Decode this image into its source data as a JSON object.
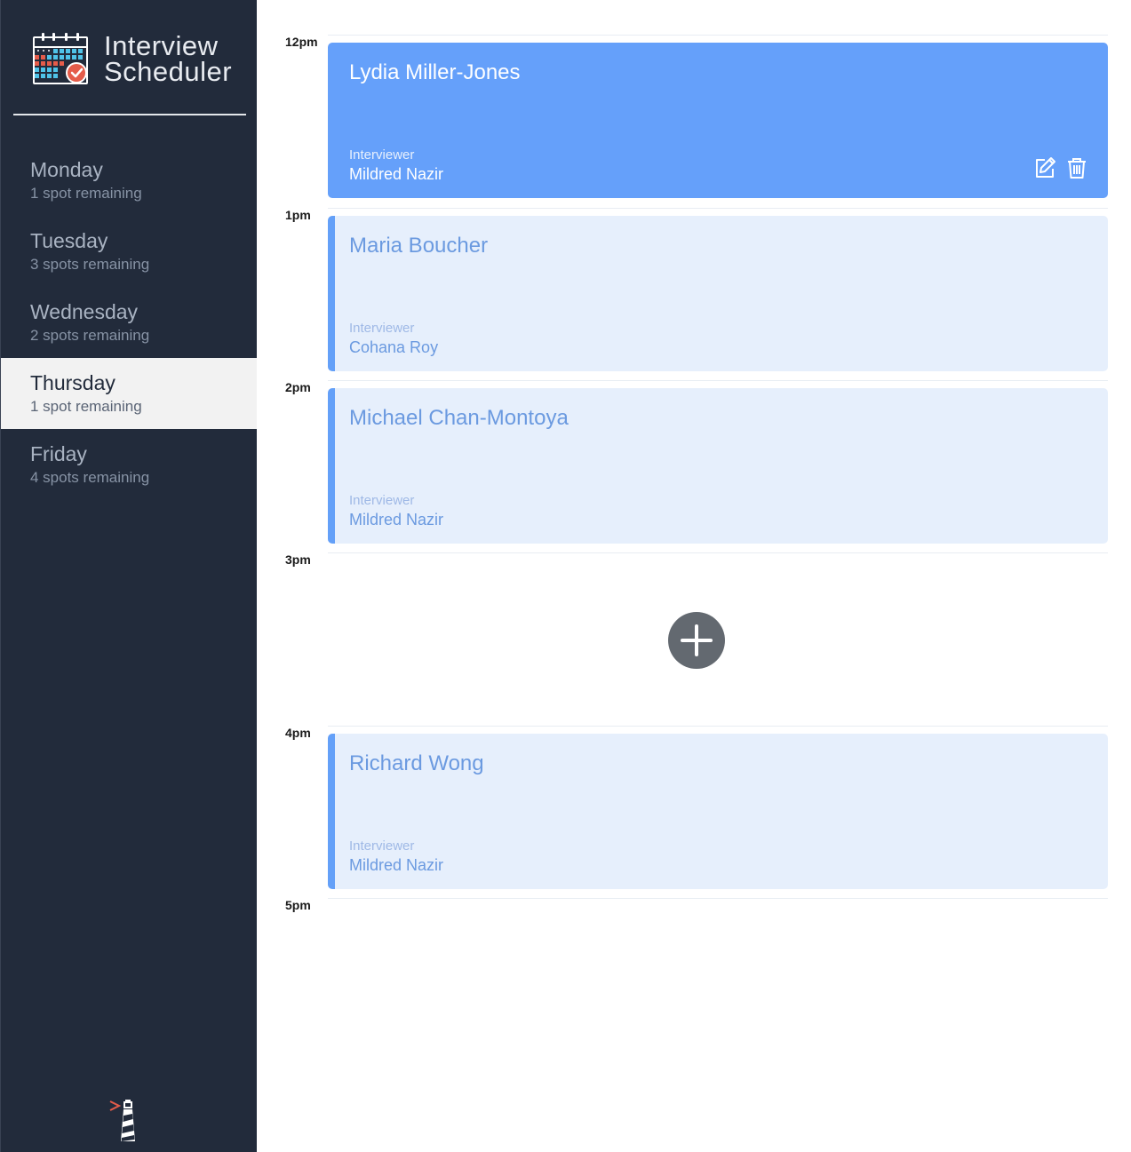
{
  "app": {
    "title_line1": "Interview",
    "title_line2": "Scheduler"
  },
  "sidebar": {
    "days": [
      {
        "name": "Monday",
        "spots": "1 spot remaining",
        "selected": false
      },
      {
        "name": "Tuesday",
        "spots": "3 spots remaining",
        "selected": false
      },
      {
        "name": "Wednesday",
        "spots": "2 spots remaining",
        "selected": false
      },
      {
        "name": "Thursday",
        "spots": "1 spot remaining",
        "selected": true
      },
      {
        "name": "Friday",
        "spots": "4 spots remaining",
        "selected": false
      }
    ],
    "footer_icon": "lighthouse-icon"
  },
  "schedule": {
    "times": [
      "12pm",
      "1pm",
      "2pm",
      "3pm",
      "4pm",
      "5pm"
    ],
    "appointments": [
      {
        "time": "12pm",
        "student": "Lydia Miller-Jones",
        "interviewer_label": "Interviewer",
        "interviewer": "Mildred Nazir",
        "active": true,
        "actions": [
          "edit-icon",
          "trash-icon"
        ]
      },
      {
        "time": "1pm",
        "student": "Maria Boucher",
        "interviewer_label": "Interviewer",
        "interviewer": "Cohana Roy",
        "active": false
      },
      {
        "time": "2pm",
        "student": "Michael Chan-Montoya",
        "interviewer_label": "Interviewer",
        "interviewer": "Mildred Nazir",
        "active": false
      },
      {
        "time": "4pm",
        "student": "Richard Wong",
        "interviewer_label": "Interviewer",
        "interviewer": "Mildred Nazir",
        "active": false
      }
    ],
    "empty_slot": {
      "time": "3pm",
      "icon": "add-icon"
    }
  },
  "colors": {
    "sidebar_bg": "#222b3b",
    "selected_bg": "#f2f2f2",
    "accent": "#65a0fa",
    "card_bg": "#e6effc",
    "add_button": "#636970"
  }
}
